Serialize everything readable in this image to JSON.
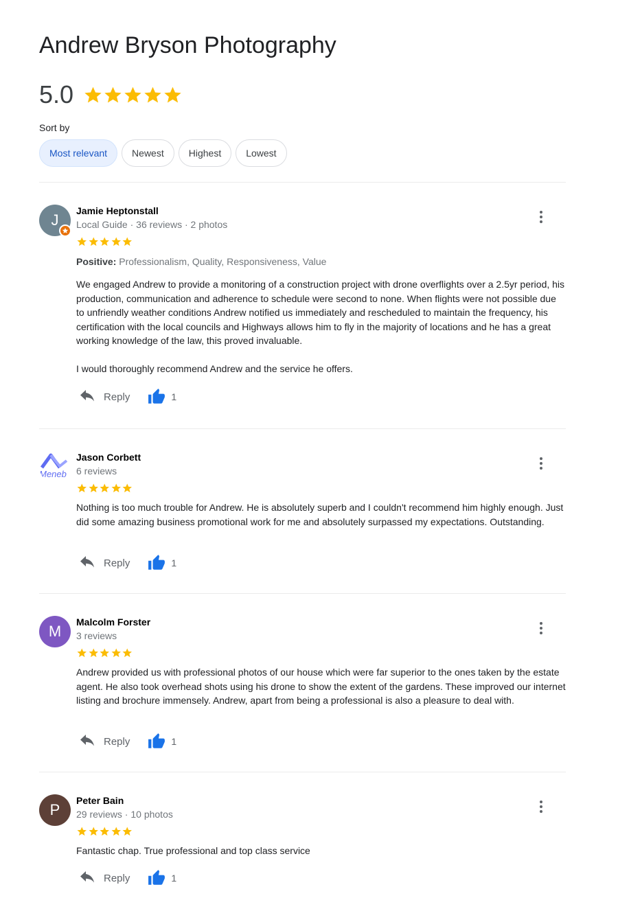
{
  "business": {
    "title": "Andrew Bryson Photography",
    "rating": "5.0",
    "rating_stars": 5
  },
  "sort": {
    "label": "Sort by",
    "options": [
      "Most relevant",
      "Newest",
      "Highest",
      "Lowest"
    ],
    "selected": "Most relevant"
  },
  "colors": {
    "star": "#fbbc04",
    "accent_blue": "#1a73e8",
    "chip_active_bg": "#e8f0fe"
  },
  "reviews": [
    {
      "avatar_letter": "J",
      "avatar_color": "#6f8591",
      "local_guide": true,
      "name": "Jamie Heptonstall",
      "meta": "Local Guide · 36 reviews · 2 photos",
      "stars": 5,
      "positive_label": "Positive:",
      "positive_text": " Professionalism, Quality, Responsiveness, Value",
      "text_1": "We engaged Andrew to provide a monitoring of a construction project with drone overflights over a 2.5yr period, his production, communication and adherence to schedule were second to none. When flights were not possible due to unfriendly weather conditions Andrew notified us immediately and rescheduled to maintain the frequency, his certification with the local councils and Highways allows him to fly in the majority of locations and he has a great working knowledge of the law, this proved invaluable.",
      "text_2": "I would thoroughly recommend Andrew and the service he offers.",
      "reply_label": "Reply",
      "likes": "1"
    },
    {
      "avatar_logo_text": "Meneb",
      "name": "Jason Corbett",
      "meta": "6 reviews",
      "stars": 5,
      "text_1": "Nothing is too much trouble for Andrew. He is absolutely superb and I couldn't recommend him highly enough. Just did some amazing business promotional work for me and absolutely surpassed my expectations. Outstanding.",
      "reply_label": "Reply",
      "likes": "1"
    },
    {
      "avatar_letter": "M",
      "avatar_color": "#7e57c2",
      "name": "Malcolm Forster",
      "meta": "3 reviews",
      "stars": 5,
      "text_1": "Andrew provided us with professional photos of our house which were far superior to the ones taken by the estate agent. He also took overhead shots using his drone to show the extent of the gardens. These improved our internet listing and brochure immensely. Andrew, apart from being a professional is also a pleasure to deal with.",
      "reply_label": "Reply",
      "likes": "1"
    },
    {
      "avatar_letter": "P",
      "avatar_color": "#5d4037",
      "name": "Peter Bain",
      "meta": "29 reviews · 10 photos",
      "stars": 5,
      "text_1": "Fantastic chap. True professional and top class service",
      "reply_label": "Reply",
      "likes": "1"
    }
  ]
}
